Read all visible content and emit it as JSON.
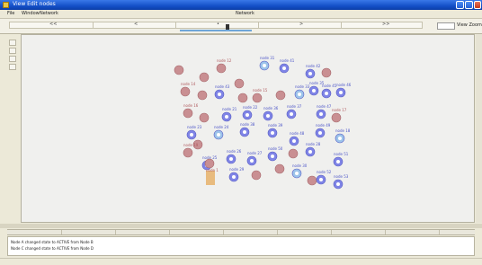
{
  "window": {
    "title": "View Edit nodes",
    "menu": [
      "File",
      "Window",
      "Network"
    ],
    "menu_center": "Network"
  },
  "toolbar": {
    "segments": [
      "<<",
      "<",
      "•",
      ">",
      ">>"
    ],
    "zoom_label": "View Zoom"
  },
  "log": {
    "lines": [
      "Node A changed state to ACTIVE from Node B",
      "Node C changed state to ACTIVE from Node D"
    ]
  },
  "colors": {
    "node_red": "#c98f92",
    "node_blue": "#7f84e6",
    "node_lightblue": "#9cc3ea",
    "node_orange": "#e6b26a",
    "label_red": "#b05c60",
    "label_blue": "#4d56c8"
  },
  "graph": {
    "nodes": [
      {
        "id": "n1",
        "type": "red",
        "label": ""
      },
      {
        "id": "n2",
        "type": "red",
        "label": ""
      },
      {
        "id": "n3",
        "type": "red",
        "label": "node 12"
      },
      {
        "id": "n4",
        "type": "lightblue",
        "label": "node 31"
      },
      {
        "id": "n5",
        "type": "blue",
        "label": "node 41"
      },
      {
        "id": "n6",
        "type": "blue",
        "label": "node 42"
      },
      {
        "id": "n7",
        "type": "red",
        "label": ""
      },
      {
        "id": "n8",
        "type": "red",
        "label": "node 14"
      },
      {
        "id": "n9",
        "type": "red",
        "label": ""
      },
      {
        "id": "n10",
        "type": "blue",
        "label": "node 43"
      },
      {
        "id": "n11",
        "type": "red",
        "label": ""
      },
      {
        "id": "n12",
        "type": "red",
        "label": ""
      },
      {
        "id": "n13",
        "type": "red",
        "label": "node 15"
      },
      {
        "id": "n14",
        "type": "red",
        "label": ""
      },
      {
        "id": "n15",
        "type": "lightblue",
        "label": "node 33"
      },
      {
        "id": "n16",
        "type": "blue",
        "label": "node 35"
      },
      {
        "id": "n17",
        "type": "blue",
        "label": "node 45"
      },
      {
        "id": "n18",
        "type": "blue",
        "label": "node 46"
      },
      {
        "id": "n19",
        "type": "red",
        "label": "node 16"
      },
      {
        "id": "n20",
        "type": "red",
        "label": ""
      },
      {
        "id": "n21",
        "type": "blue",
        "label": "node 21"
      },
      {
        "id": "n22",
        "type": "blue",
        "label": "node 22"
      },
      {
        "id": "n23",
        "type": "blue",
        "label": "node 36"
      },
      {
        "id": "n24",
        "type": "blue",
        "label": "node 37"
      },
      {
        "id": "n25",
        "type": "blue",
        "label": "node 47"
      },
      {
        "id": "n26",
        "type": "red",
        "label": "node 17"
      },
      {
        "id": "n27",
        "type": "blue",
        "label": "node 23"
      },
      {
        "id": "n28",
        "type": "lightblue",
        "label": "node 24"
      },
      {
        "id": "n29",
        "type": "blue",
        "label": "node 38"
      },
      {
        "id": "n30",
        "type": "blue",
        "label": "node 39"
      },
      {
        "id": "n31",
        "type": "blue",
        "label": "node 48"
      },
      {
        "id": "n32",
        "type": "blue",
        "label": "node 49"
      },
      {
        "id": "n33",
        "type": "lightblue",
        "label": "node 18"
      },
      {
        "id": "n34",
        "type": "red",
        "label": ""
      },
      {
        "id": "n35",
        "type": "red",
        "label": "node 19"
      },
      {
        "id": "n36",
        "type": "blue",
        "label": "node 25"
      },
      {
        "id": "n37",
        "type": "blue",
        "label": "node 26"
      },
      {
        "id": "n38",
        "type": "blue",
        "label": "node 27"
      },
      {
        "id": "n39",
        "type": "blue",
        "label": "node 50"
      },
      {
        "id": "n40",
        "type": "red",
        "label": ""
      },
      {
        "id": "n41",
        "type": "blue",
        "label": "node 28"
      },
      {
        "id": "n42",
        "type": "red",
        "label": ""
      },
      {
        "id": "n43",
        "type": "blue",
        "label": "node 29"
      },
      {
        "id": "n44",
        "type": "red",
        "label": ""
      },
      {
        "id": "n45",
        "type": "red",
        "label": ""
      },
      {
        "id": "n46",
        "type": "lightblue",
        "label": "node 30"
      },
      {
        "id": "n47",
        "type": "red",
        "label": ""
      },
      {
        "id": "n48",
        "type": "blue",
        "label": "node 51"
      },
      {
        "id": "n49",
        "type": "blue",
        "label": "node 52"
      },
      {
        "id": "n50",
        "type": "blue",
        "label": "node 53"
      },
      {
        "id": "n51",
        "type": "orange",
        "label": "node 1"
      }
    ]
  }
}
